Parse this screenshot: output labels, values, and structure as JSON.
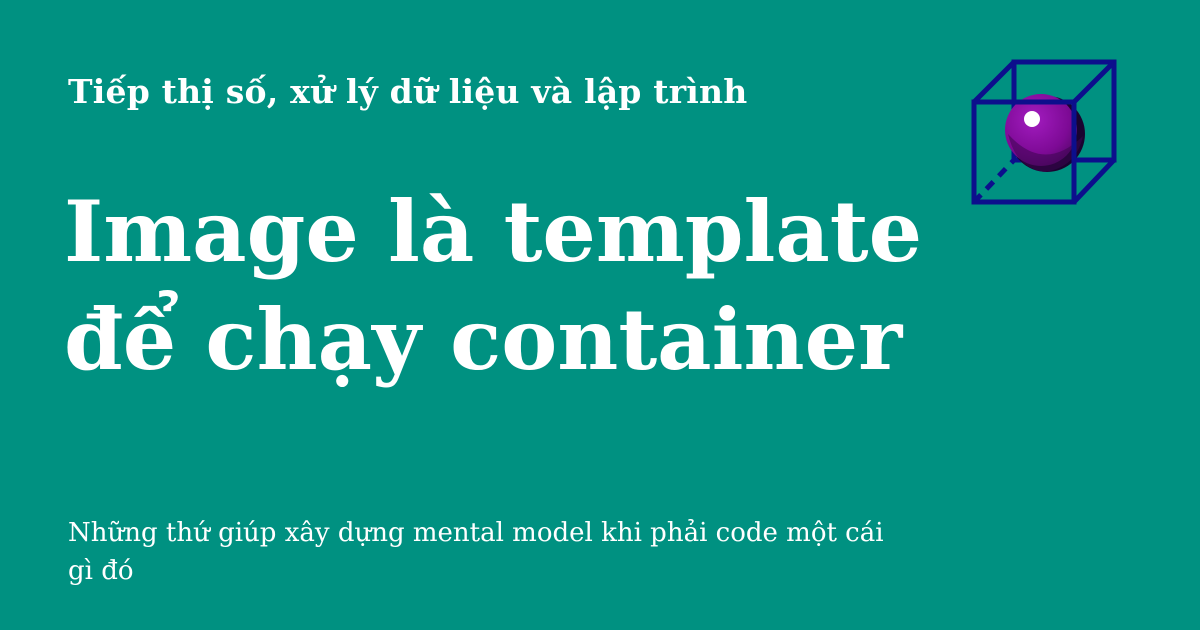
{
  "colors": {
    "background": "#009181",
    "text": "#ffffff",
    "cube_stroke": "#0c0f8c",
    "sphere": "#8a0aa0",
    "sphere_shadow": "#2a0540"
  },
  "site": {
    "title": "Tiếp thị số, xử lý dữ liệu và lập trình"
  },
  "article": {
    "headline_line1": "Image là template",
    "headline_line2": "để chạy container",
    "subtitle": "Những thứ giúp xây dựng mental model khi phải code một cái gì đó"
  },
  "logo": {
    "icon": "cube-sphere-icon"
  }
}
